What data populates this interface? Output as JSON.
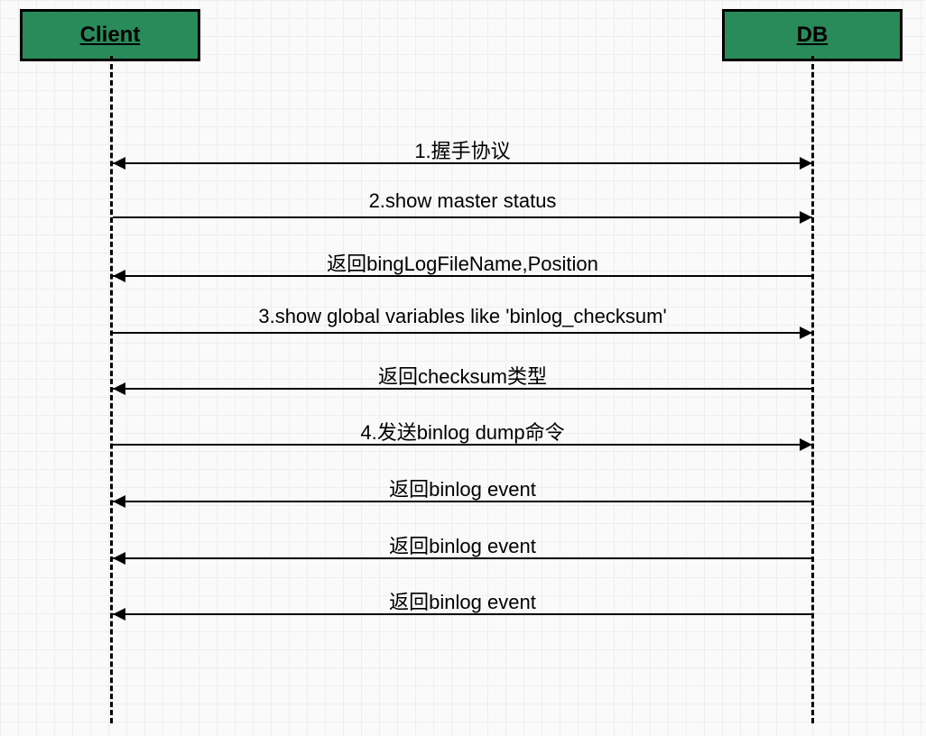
{
  "participants": {
    "left": "Client",
    "right": "DB"
  },
  "messages": [
    {
      "label": "1.握手协议",
      "direction": "both",
      "labelY": 150,
      "arrowY": 180
    },
    {
      "label": "2.show master status",
      "direction": "right",
      "labelY": 210,
      "arrowY": 240
    },
    {
      "label": "返回bingLogFileName,Position",
      "direction": "left",
      "labelY": 275,
      "arrowY": 305
    },
    {
      "label": "3.show global variables like 'binlog_checksum'",
      "direction": "right",
      "labelY": 338,
      "arrowY": 368
    },
    {
      "label": "返回checksum类型",
      "direction": "left",
      "labelY": 400,
      "arrowY": 430
    },
    {
      "label": "4.发送binlog dump命令",
      "direction": "right",
      "labelY": 462,
      "arrowY": 492
    },
    {
      "label": "返回binlog event",
      "direction": "left",
      "labelY": 525,
      "arrowY": 555
    },
    {
      "label": "返回binlog event",
      "direction": "left",
      "labelY": 588,
      "arrowY": 618
    },
    {
      "label": "返回binlog event",
      "direction": "left",
      "labelY": 650,
      "arrowY": 680
    }
  ]
}
